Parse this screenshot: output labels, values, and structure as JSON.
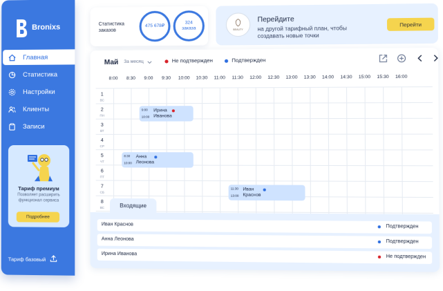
{
  "app": {
    "name": "Bronixs"
  },
  "nav": [
    {
      "label": "Главная",
      "icon": "home-icon",
      "active": true
    },
    {
      "label": "Статистика",
      "icon": "pie-chart-icon",
      "active": false
    },
    {
      "label": "Настройки",
      "icon": "gear-icon",
      "active": false
    },
    {
      "label": "Клиенты",
      "icon": "users-icon",
      "active": false
    },
    {
      "label": "Записи",
      "icon": "clipboard-icon",
      "active": false
    }
  ],
  "premium": {
    "title": "Тариф премиум",
    "description": "Позволяет расширить функционал сервиса",
    "button": "Подробнее"
  },
  "footer": {
    "tariff": "Тариф базовый"
  },
  "stats": {
    "label": "Статистика заказов",
    "revenue": "475 678₽",
    "orders_count": "324",
    "orders_label": "заказа"
  },
  "promo": {
    "title": "Перейдите",
    "subtitle": "на другой тарифный план, чтобы создавать новые точки",
    "logo_text": "BEAUTY",
    "button": "Перейти"
  },
  "calendar": {
    "month": "Май",
    "period": "За месяц",
    "legend": [
      {
        "label": "Не подтвержден",
        "color": "#d8232a"
      },
      {
        "label": "Подтвержден",
        "color": "#2f6fe0"
      }
    ],
    "times": [
      "8:00",
      "8:30",
      "9:00",
      "9:30",
      "10:00",
      "10:30",
      "11:00",
      "11:30",
      "12:00",
      "12:30",
      "13:00",
      "13:30",
      "14:00",
      "14:30",
      "15:00",
      "15:30",
      "16:00"
    ],
    "days": [
      {
        "num": "1",
        "wd": "ВС"
      },
      {
        "num": "2",
        "wd": "ПН"
      },
      {
        "num": "3",
        "wd": "ВТ"
      },
      {
        "num": "4",
        "wd": "СР"
      },
      {
        "num": "5",
        "wd": "ЧТ"
      },
      {
        "num": "6",
        "wd": "ПТ"
      },
      {
        "num": "7",
        "wd": "СБ"
      },
      {
        "num": "8",
        "wd": "ВС"
      }
    ],
    "events": [
      {
        "start": "9:00",
        "end": "10:00",
        "name": "Ирина Иванова",
        "status_color": "#d8232a"
      },
      {
        "start": "8:30",
        "end": "10:00",
        "name": "Анна Леонова",
        "status_color": "#2f6fe0"
      },
      {
        "start": "11:30",
        "end": "13:00",
        "name": "Иван Краснов",
        "status_color": "#2f6fe0"
      }
    ]
  },
  "incoming": {
    "tab": "Входящие",
    "rows": [
      {
        "name": "Иван Краснов",
        "status": "Подтвержден",
        "color": "#2f6fe0"
      },
      {
        "name": "Анна Леонова",
        "status": "Подтвержден",
        "color": "#2f6fe0"
      },
      {
        "name": "Ирина Иванова",
        "status": "Не подтвержден",
        "color": "#d8232a"
      }
    ]
  }
}
